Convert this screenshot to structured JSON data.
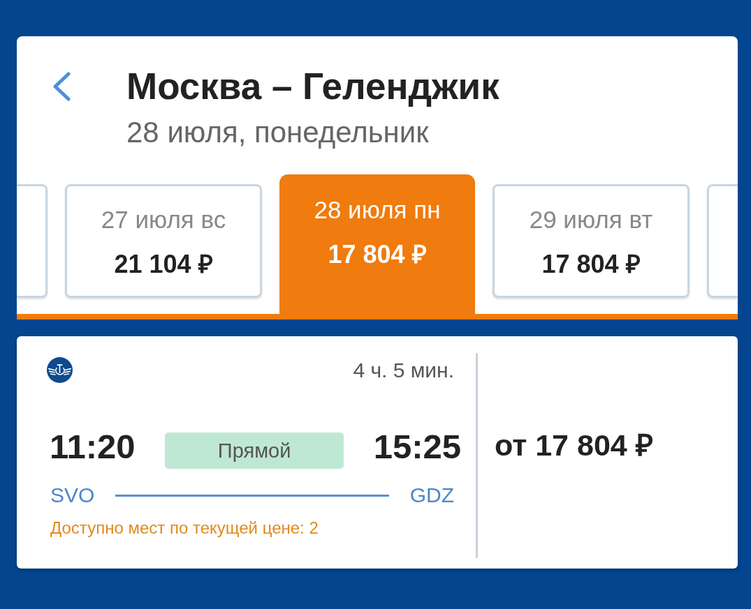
{
  "header": {
    "title": "Москва – Геленджик",
    "subtitle": "28 июля, понедельник"
  },
  "date_tabs": [
    {
      "kind": "partial",
      "selected": false
    },
    {
      "kind": "full",
      "date": "27 июля вс",
      "price": "21 104 ₽",
      "selected": false
    },
    {
      "kind": "full",
      "date": "28 июля пн",
      "price": "17 804 ₽",
      "selected": true
    },
    {
      "kind": "full",
      "date": "29 июля вт",
      "price": "17 804 ₽",
      "selected": false
    },
    {
      "kind": "partial",
      "selected": false
    }
  ],
  "flight": {
    "duration": "4 ч. 5 мин.",
    "departure_time": "11:20",
    "stops_badge": "Прямой",
    "arrival_time": "15:25",
    "departure_airport": "SVO",
    "arrival_airport": "GDZ",
    "seats_note": "Доступно мест по текущей цене: 2",
    "price": "от 17 804 ₽"
  }
}
